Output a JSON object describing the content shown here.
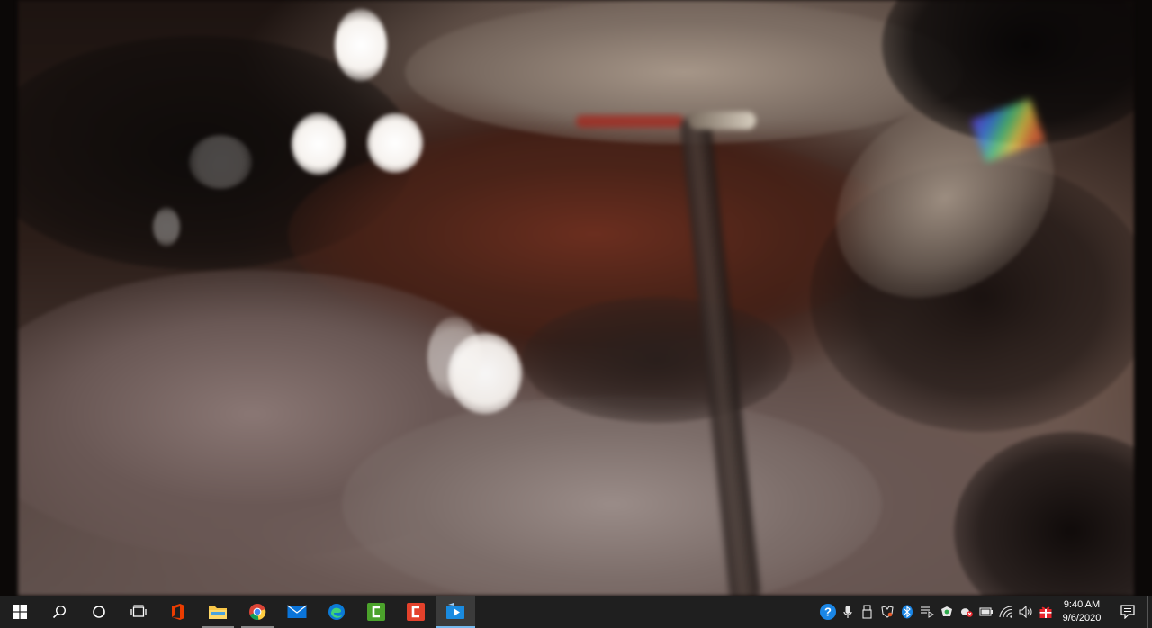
{
  "video": {
    "description_icon": "surgical-video-frame"
  },
  "taskbar": {
    "apps": [
      {
        "name": "start-button",
        "icon": "windows-logo"
      },
      {
        "name": "search-button",
        "icon": "search-icon"
      },
      {
        "name": "cortana-button",
        "icon": "circle-icon"
      },
      {
        "name": "task-view-button",
        "icon": "task-view-icon"
      },
      {
        "name": "office-app",
        "icon": "office-icon"
      },
      {
        "name": "file-explorer-app",
        "icon": "folder-icon"
      },
      {
        "name": "chrome-app",
        "icon": "chrome-icon"
      },
      {
        "name": "mail-app",
        "icon": "mail-icon"
      },
      {
        "name": "edge-app",
        "icon": "edge-icon"
      },
      {
        "name": "camtasia-recorder-app",
        "icon": "camtasia-green-icon"
      },
      {
        "name": "camtasia-app",
        "icon": "camtasia-red-icon"
      },
      {
        "name": "media-player-app",
        "icon": "media-player-icon"
      }
    ],
    "tray": {
      "icons": [
        "help-icon",
        "microphone-icon",
        "usb-icon",
        "shield-icon",
        "bluetooth-icon",
        "touch-keyboard-icon",
        "sync-icon",
        "security-icon",
        "battery-icon",
        "wifi-icon",
        "volume-icon",
        "gift-icon"
      ]
    },
    "clock": {
      "time": "9:40 AM",
      "date": "9/6/2020"
    },
    "accent": "#76b9ed",
    "background": "#1f1f1f"
  }
}
